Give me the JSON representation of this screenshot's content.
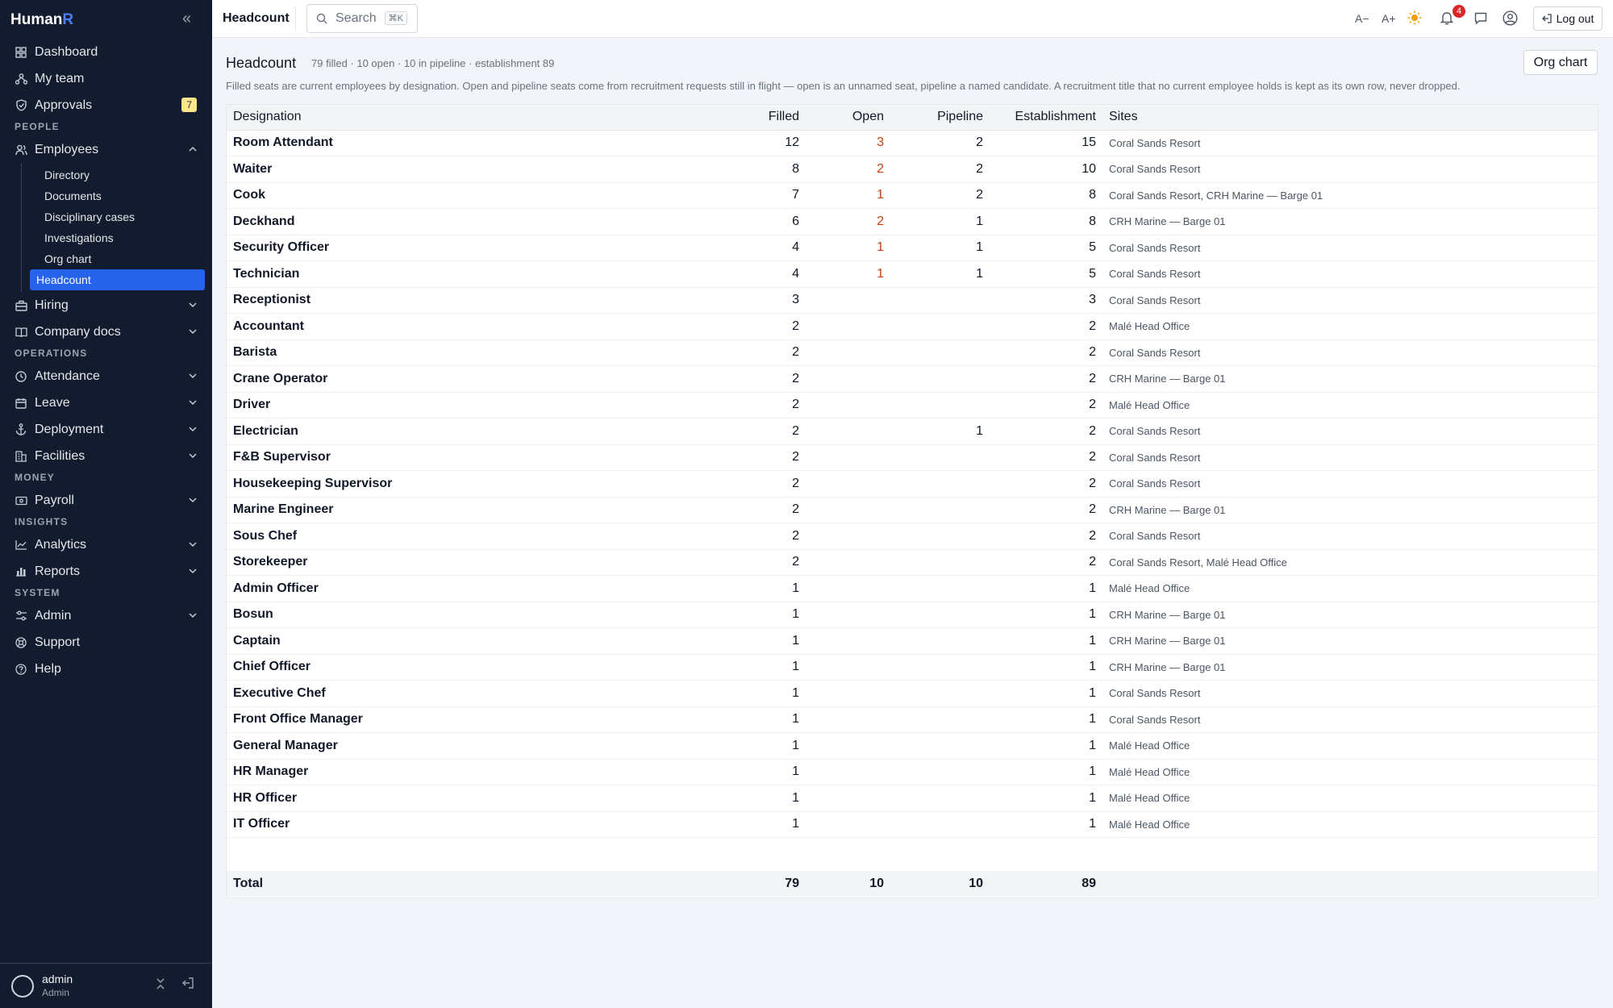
{
  "sidebar": {
    "brand_main": "Human",
    "brand_accent": "R",
    "top_items": [
      {
        "label": "Dashboard",
        "icon": "grid-icon"
      },
      {
        "label": "My team",
        "icon": "team-icon"
      },
      {
        "label": "Approvals",
        "icon": "shield-icon",
        "badge": "7"
      }
    ],
    "section_people": "PEOPLE",
    "employees": "Employees",
    "employees_sub": [
      "Directory",
      "Documents",
      "Disciplinary cases",
      "Investigations",
      "Org chart",
      "Headcount"
    ],
    "hiring": "Hiring",
    "company_docs": "Company docs",
    "section_operations": "OPERATIONS",
    "operations": [
      "Attendance",
      "Leave",
      "Deployment",
      "Facilities"
    ],
    "section_money": "MONEY",
    "payroll": "Payroll",
    "section_insights": "INSIGHTS",
    "analytics": "Analytics",
    "reports": "Reports",
    "section_system": "SYSTEM",
    "admin": "Admin",
    "support": "Support",
    "help": "Help",
    "user": {
      "name": "admin",
      "role": "Admin"
    }
  },
  "topbar": {
    "title": "Headcount",
    "search_placeholder": "Search",
    "search_shortcut": "⌘K",
    "font_dec": "A−",
    "font_inc": "A+",
    "notifications": "4",
    "logout": "Log out"
  },
  "main": {
    "title": "Headcount",
    "stats": "79 filled · 10 open · 10 in pipeline · establishment 89",
    "description": "Filled seats are current employees by designation. Open and pipeline seats come from recruitment requests still in flight — open is an unnamed seat, pipeline a named candidate. A recruitment title that no current employee holds is kept as its own row, never dropped.",
    "org_chart_button": "Org chart",
    "columns": [
      "Designation",
      "Filled",
      "Open",
      "Pipeline",
      "Establishment",
      "Sites"
    ],
    "rows": [
      {
        "designation": "Room Attendant",
        "filled": "12",
        "open": "3",
        "pipeline": "2",
        "establishment": "15",
        "sites": "Coral Sands Resort"
      },
      {
        "designation": "Waiter",
        "filled": "8",
        "open": "2",
        "pipeline": "2",
        "establishment": "10",
        "sites": "Coral Sands Resort"
      },
      {
        "designation": "Cook",
        "filled": "7",
        "open": "1",
        "pipeline": "2",
        "establishment": "8",
        "sites": "Coral Sands Resort, CRH Marine — Barge 01"
      },
      {
        "designation": "Deckhand",
        "filled": "6",
        "open": "2",
        "pipeline": "1",
        "establishment": "8",
        "sites": "CRH Marine — Barge 01"
      },
      {
        "designation": "Security Officer",
        "filled": "4",
        "open": "1",
        "pipeline": "1",
        "establishment": "5",
        "sites": "Coral Sands Resort"
      },
      {
        "designation": "Technician",
        "filled": "4",
        "open": "1",
        "pipeline": "1",
        "establishment": "5",
        "sites": "Coral Sands Resort"
      },
      {
        "designation": "Receptionist",
        "filled": "3",
        "open": "",
        "pipeline": "",
        "establishment": "3",
        "sites": "Coral Sands Resort"
      },
      {
        "designation": "Accountant",
        "filled": "2",
        "open": "",
        "pipeline": "",
        "establishment": "2",
        "sites": "Malé Head Office"
      },
      {
        "designation": "Barista",
        "filled": "2",
        "open": "",
        "pipeline": "",
        "establishment": "2",
        "sites": "Coral Sands Resort"
      },
      {
        "designation": "Crane Operator",
        "filled": "2",
        "open": "",
        "pipeline": "",
        "establishment": "2",
        "sites": "CRH Marine — Barge 01"
      },
      {
        "designation": "Driver",
        "filled": "2",
        "open": "",
        "pipeline": "",
        "establishment": "2",
        "sites": "Malé Head Office"
      },
      {
        "designation": "Electrician",
        "filled": "2",
        "open": "",
        "pipeline": "1",
        "establishment": "2",
        "sites": "Coral Sands Resort"
      },
      {
        "designation": "F&B Supervisor",
        "filled": "2",
        "open": "",
        "pipeline": "",
        "establishment": "2",
        "sites": "Coral Sands Resort"
      },
      {
        "designation": "Housekeeping Supervisor",
        "filled": "2",
        "open": "",
        "pipeline": "",
        "establishment": "2",
        "sites": "Coral Sands Resort"
      },
      {
        "designation": "Marine Engineer",
        "filled": "2",
        "open": "",
        "pipeline": "",
        "establishment": "2",
        "sites": "CRH Marine — Barge 01"
      },
      {
        "designation": "Sous Chef",
        "filled": "2",
        "open": "",
        "pipeline": "",
        "establishment": "2",
        "sites": "Coral Sands Resort"
      },
      {
        "designation": "Storekeeper",
        "filled": "2",
        "open": "",
        "pipeline": "",
        "establishment": "2",
        "sites": "Coral Sands Resort, Malé Head Office"
      },
      {
        "designation": "Admin Officer",
        "filled": "1",
        "open": "",
        "pipeline": "",
        "establishment": "1",
        "sites": "Malé Head Office"
      },
      {
        "designation": "Bosun",
        "filled": "1",
        "open": "",
        "pipeline": "",
        "establishment": "1",
        "sites": "CRH Marine — Barge 01"
      },
      {
        "designation": "Captain",
        "filled": "1",
        "open": "",
        "pipeline": "",
        "establishment": "1",
        "sites": "CRH Marine — Barge 01"
      },
      {
        "designation": "Chief Officer",
        "filled": "1",
        "open": "",
        "pipeline": "",
        "establishment": "1",
        "sites": "CRH Marine — Barge 01"
      },
      {
        "designation": "Executive Chef",
        "filled": "1",
        "open": "",
        "pipeline": "",
        "establishment": "1",
        "sites": "Coral Sands Resort"
      },
      {
        "designation": "Front Office Manager",
        "filled": "1",
        "open": "",
        "pipeline": "",
        "establishment": "1",
        "sites": "Coral Sands Resort"
      },
      {
        "designation": "General Manager",
        "filled": "1",
        "open": "",
        "pipeline": "",
        "establishment": "1",
        "sites": "Malé Head Office"
      },
      {
        "designation": "HR Manager",
        "filled": "1",
        "open": "",
        "pipeline": "",
        "establishment": "1",
        "sites": "Malé Head Office"
      },
      {
        "designation": "HR Officer",
        "filled": "1",
        "open": "",
        "pipeline": "",
        "establishment": "1",
        "sites": "Malé Head Office"
      },
      {
        "designation": "IT Officer",
        "filled": "1",
        "open": "",
        "pipeline": "",
        "establishment": "1",
        "sites": "Malé Head Office"
      }
    ],
    "total": {
      "label": "Total",
      "filled": "79",
      "open": "10",
      "pipeline": "10",
      "establishment": "89"
    }
  },
  "colors": {
    "sidebar_bg": "#121c2e",
    "accent": "#2563eb",
    "open_value": "#c2410c",
    "badge": "#fde68a",
    "notification": "#dc2626"
  }
}
